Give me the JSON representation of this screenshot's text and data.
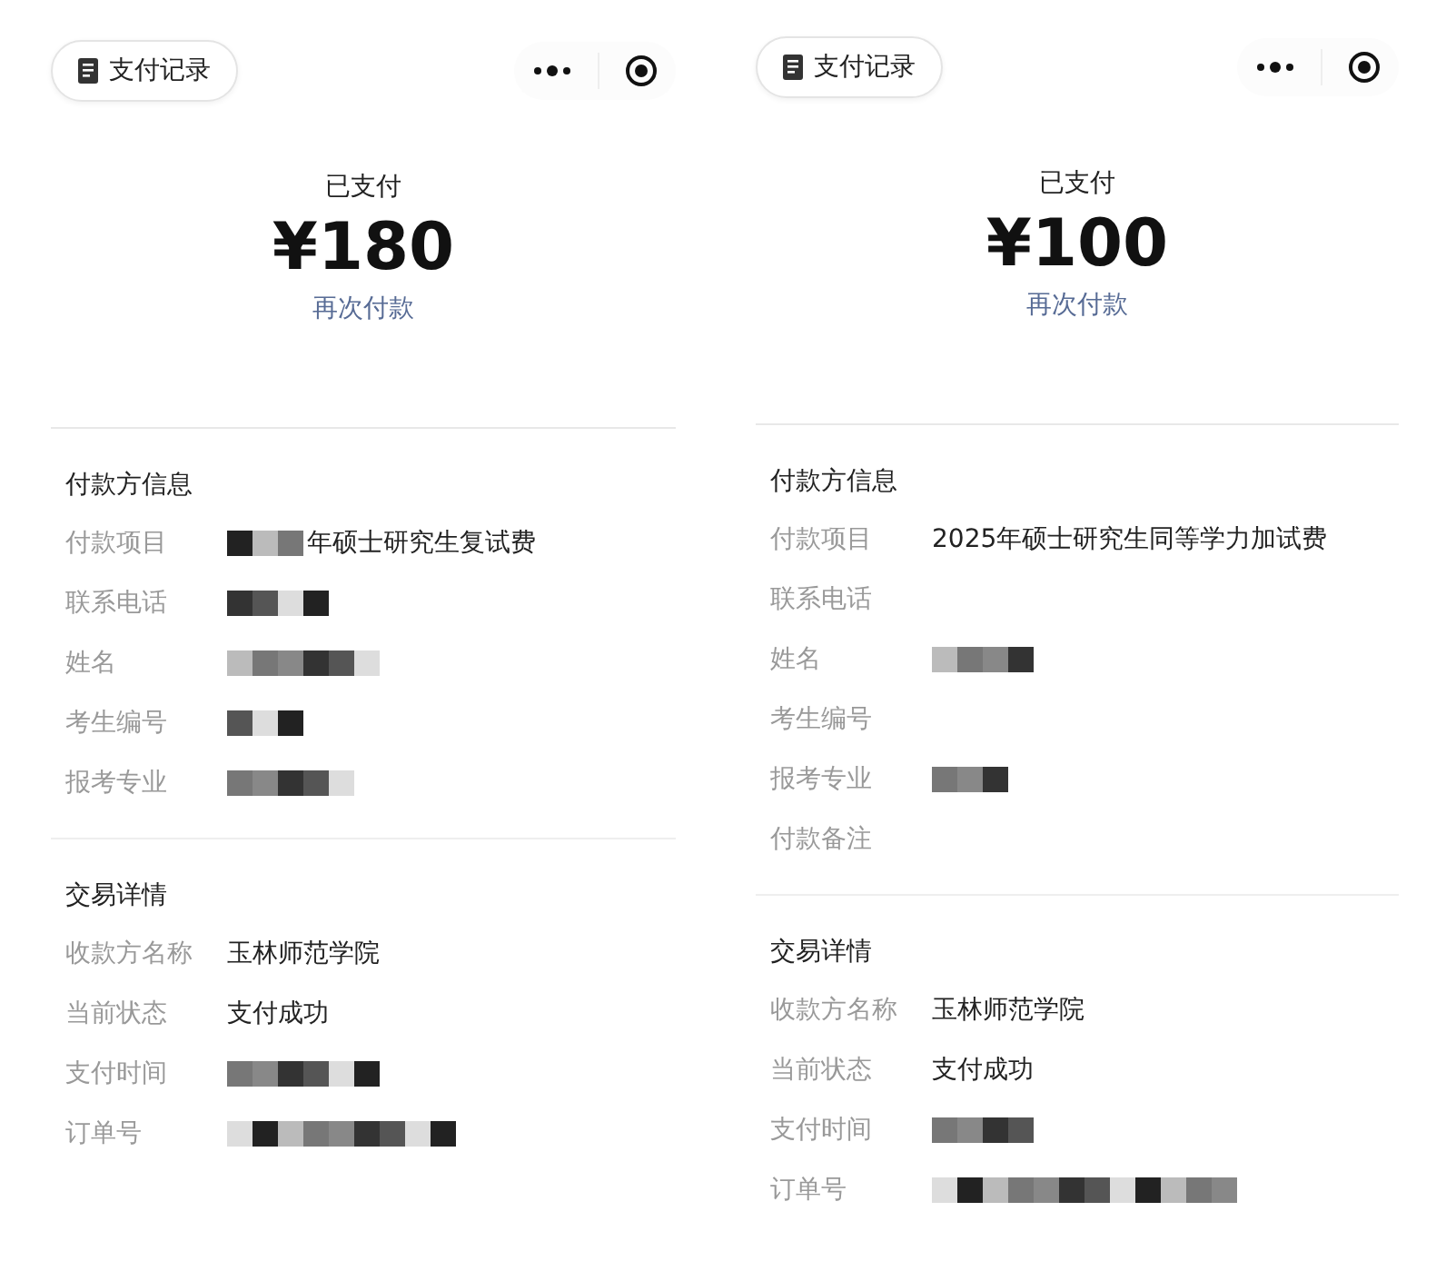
{
  "screens": [
    {
      "records_button": "支付记录",
      "status": "已支付",
      "amount": "¥180",
      "pay_again_link": "再次付款",
      "sections": [
        {
          "title": "付款方信息",
          "rows": [
            {
              "label": "付款项目",
              "value": "年硕士研究生复试费",
              "redacted": true
            },
            {
              "label": "联系电话",
              "redacted": true
            },
            {
              "label": "姓名",
              "redacted": true
            },
            {
              "label": "考生编号",
              "redacted": true
            },
            {
              "label": "报考专业",
              "redacted": true
            }
          ]
        },
        {
          "title": "交易详情",
          "rows": [
            {
              "label": "收款方名称",
              "value": "玉林师范学院",
              "redacted": false
            },
            {
              "label": "当前状态",
              "value": "支付成功",
              "redacted": false
            },
            {
              "label": "支付时间",
              "redacted": true
            },
            {
              "label": "订单号",
              "redacted": true
            }
          ]
        }
      ]
    },
    {
      "records_button": "支付记录",
      "status": "已支付",
      "amount": "¥100",
      "pay_again_link": "再次付款",
      "sections": [
        {
          "title": "付款方信息",
          "rows": [
            {
              "label": "付款项目",
              "value": "2025年硕士研究生同等学力加试费",
              "redacted": false
            },
            {
              "label": "联系电话",
              "redacted": false
            },
            {
              "label": "姓名",
              "redacted": true
            },
            {
              "label": "考生编号",
              "redacted": false
            },
            {
              "label": "报考专业",
              "redacted": true
            },
            {
              "label": "付款备注",
              "redacted": false
            }
          ]
        },
        {
          "title": "交易详情",
          "rows": [
            {
              "label": "收款方名称",
              "value": "玉林师范学院",
              "redacted": false
            },
            {
              "label": "当前状态",
              "value": "支付成功",
              "redacted": false
            },
            {
              "label": "支付时间",
              "redacted": true
            },
            {
              "label": "订单号",
              "redacted": true
            }
          ]
        }
      ]
    }
  ]
}
